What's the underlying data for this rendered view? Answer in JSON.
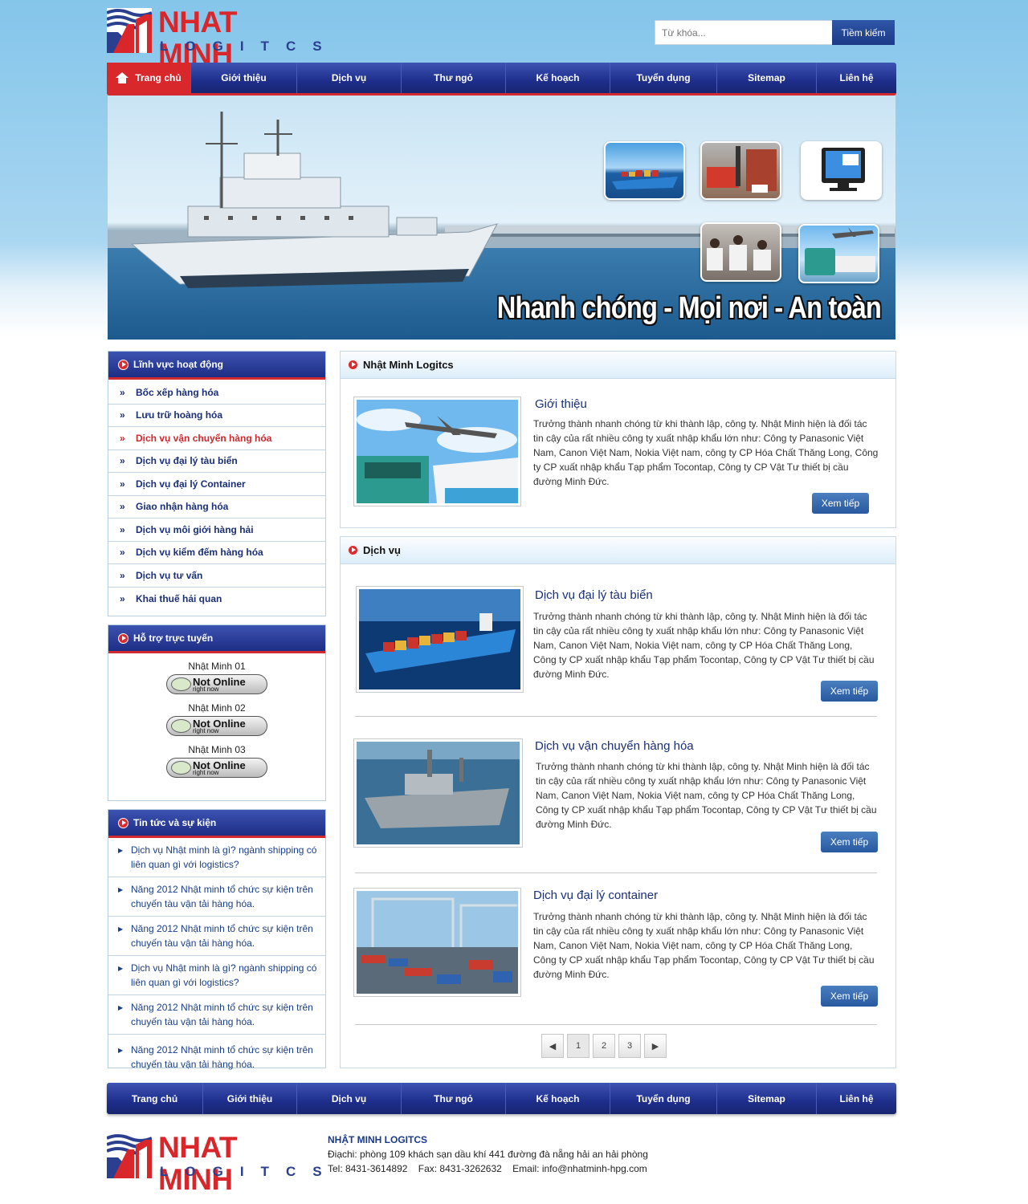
{
  "header": {
    "logo_line1": "NHAT MINH",
    "logo_line2": "LOGITCS",
    "search_placeholder": "Từ khóa...",
    "search_button": "Tiềm kiếm"
  },
  "nav": {
    "items": [
      "Trang chủ",
      "Giới thiệu",
      "Dịch vụ",
      "Thư ngỏ",
      "Kế hoạch",
      "Tuyển dụng",
      "Sitemap",
      "Liên hệ"
    ]
  },
  "banner": {
    "slogan": "Nhanh chóng - Mọi nơi - An toàn"
  },
  "sidebar": {
    "fields": {
      "title": "Lĩnh vực hoạt động",
      "items": [
        "Bốc xếp hàng hóa",
        "Lưu trữ hoàng hóa",
        "Dịch vụ vận chuyển hàng hóa",
        "Dịch vụ đại lý tàu biển",
        "Dịch vụ đại lý Container",
        "Giao nhận hàng hóa",
        "Dịch vụ môi giới hàng hải",
        "Dịch vụ kiểm đếm hàng hóa",
        "Dịch vụ tư vấn",
        "Khai thuế hải quan"
      ]
    },
    "support": {
      "title": "Hỗ trợ trực tuyến",
      "agents": [
        "Nhật Minh 01",
        "Nhật Minh 02",
        "Nhật Minh 03"
      ],
      "status_line1": "Not Online",
      "status_line2": "right now"
    },
    "news": {
      "title": "Tin tức và sự kiện",
      "items": [
        "Dịch vụ Nhật minh là gì? ngành shipping có liên quan gì với logistics?",
        "Năng 2012 Nhật minh tổ chức sự kiện trên chuyến tàu vận tải hàng hóa.",
        "Năng 2012 Nhật minh tổ chức sự kiện trên chuyến tàu vận tải hàng hóa.",
        "Dịch vụ Nhật minh là gì? ngành shipping có liên quan gì với logistics?",
        "Năng 2012 Nhật minh tổ chức sự kiện trên chuyến tàu vận tải hàng hóa.",
        "Năng 2012 Nhật minh tổ chức sự kiện trên chuyến tàu vận tải hàng hóa."
      ]
    }
  },
  "intro": {
    "panel_title": "Nhật Minh Logitcs",
    "heading": "Giới thiệu",
    "text": "Trưởng thành nhanh chóng từ khi thành lập, công ty.  Nhật Minh hiện là đối tác tin cậy của rất nhiều công ty xuất nhập khẩu lớn như: Công ty Panasonic Việt Nam, Canon Việt Nam, Nokia Việt nam, công ty CP Hóa Chất Thăng Long, Công ty CP xuất nhập khẩu Tạp phẩm Tocontap, Công ty CP Vật Tư thiết bị cầu đường Minh Đức.",
    "more": "Xem tiếp"
  },
  "services": {
    "panel_title": "Dịch vụ",
    "items": [
      {
        "title": "Dịch vụ đại lý tàu biển",
        "text": "Trưởng thành nhanh chóng từ khi thành lập, công ty.  Nhật Minh hiện là đối tác tin cậy của rất nhiều công ty xuất nhập khẩu lớn như: Công ty Panasonic Việt Nam, Canon Việt Nam, Nokia Việt nam, công ty CP Hóa Chất Thăng Long, Công ty CP xuất nhập khẩu Tạp phẩm Tocontap, Công ty CP Vật Tư thiết bị cầu đường Minh Đức.",
        "more": "Xem tiếp"
      },
      {
        "title": "Dịch vụ vận chuyển hàng hóa",
        "text": "Trưởng thành nhanh chóng từ khi thành lập, công ty.  Nhật Minh hiện là đối tác tin cậy của rất nhiều công ty xuất nhập khẩu lớn như: Công ty Panasonic Việt Nam, Canon Việt Nam, Nokia Việt nam, công ty CP Hóa Chất Thăng Long, Công ty CP xuất nhập khẩu Tạp phẩm Tocontap, Công ty CP Vật Tư thiết bị cầu đường Minh Đức.",
        "more": "Xem tiếp"
      },
      {
        "title": "Dịch vụ đại lý container",
        "text": "Trưởng thành nhanh chóng từ khi thành lập, công ty.  Nhật Minh hiện là đối tác tin cậy của rất nhiều công ty xuất nhập khẩu lớn như: Công ty Panasonic Việt Nam, Canon Việt Nam, Nokia Việt nam, công ty CP Hóa Chất Thăng Long, Công ty CP xuất nhập khẩu Tạp phẩm Tocontap, Công ty CP Vật Tư thiết bị cầu đường Minh Đức.",
        "more": "Xem tiếp"
      }
    ],
    "pager": {
      "prev": "◀",
      "pages": [
        "1",
        "2",
        "3"
      ],
      "next": "▶",
      "current": "1"
    }
  },
  "footer": {
    "company": "NHẬT MINH LOGITCS",
    "address": "Điạchi: phòng 109 khách sạn dầu khí 441 đường đà nẵng hải an hải phòng",
    "contact": "Tel: 8431-3614892    Fax: 8431-3262632    Email: info@nhatminh-hpg.com"
  },
  "colors": {
    "brand_red": "#d8262a",
    "brand_blue": "#2a3f8f",
    "nav_blue": "#1e2e8c",
    "link_blue": "#1a2f78"
  }
}
